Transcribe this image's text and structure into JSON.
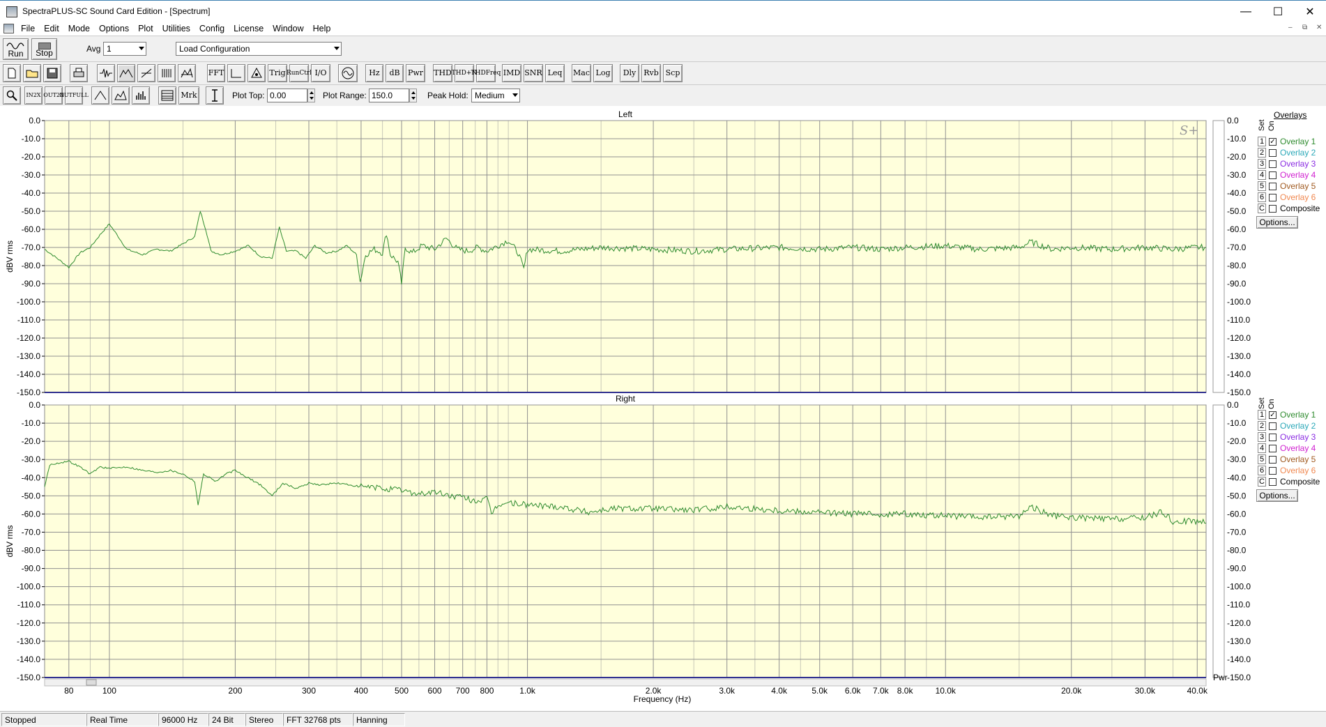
{
  "window": {
    "title": "SpectraPLUS-SC Sound Card Edition - [Spectrum]",
    "minimize_glyph": "—",
    "maximize_glyph": "☐",
    "close_glyph": "✕",
    "mdi_controls": [
      "–",
      "⧉",
      "✕"
    ]
  },
  "menu": [
    "File",
    "Edit",
    "Mode",
    "Options",
    "Plot",
    "Utilities",
    "Config",
    "License",
    "Window",
    "Help"
  ],
  "toolbar1": {
    "run_label": "Run",
    "stop_label": "Stop",
    "avg_label": "Avg",
    "avg_value": "1",
    "config_value": "Load Configuration"
  },
  "toolbar2": {
    "buttons": [
      "FFT",
      "Trig",
      "Run Ctrl",
      "I/O",
      "Hz",
      "dB",
      "Pwr",
      "THD",
      "THD +N",
      "THD Freq",
      "IMD",
      "SNR",
      "Leq",
      "Mac",
      "Log",
      "Dly",
      "Rvb",
      "Scp"
    ]
  },
  "toolbar3": {
    "zoom_buttons": [
      "IN 2X",
      "OUT 2X",
      "OUT FULL"
    ],
    "mrk_label": "Mrk",
    "plot_top_label": "Plot Top:",
    "plot_top_value": "0.00",
    "plot_range_label": "Plot Range:",
    "plot_range_value": "150.0",
    "peak_hold_label": "Peak Hold:",
    "peak_hold_value": "Medium"
  },
  "overlays": {
    "title": "Overlays",
    "set_label": "Set",
    "on_label": "On",
    "items": [
      {
        "set": "1",
        "label": "Overlay 1",
        "color": "#2e8b2e",
        "checked": true
      },
      {
        "set": "2",
        "label": "Overlay 2",
        "color": "#2aa8b8",
        "checked": false
      },
      {
        "set": "3",
        "label": "Overlay 3",
        "color": "#8a2be2",
        "checked": false
      },
      {
        "set": "4",
        "label": "Overlay 4",
        "color": "#d020d0",
        "checked": false
      },
      {
        "set": "5",
        "label": "Overlay 5",
        "color": "#a05a20",
        "checked": false
      },
      {
        "set": "6",
        "label": "Overlay 6",
        "color": "#f08850",
        "checked": false
      },
      {
        "set": "C",
        "label": "Composite",
        "color": "#000000",
        "checked": false
      }
    ],
    "options_label": "Options..."
  },
  "status": [
    "Stopped",
    "Real Time",
    "96000 Hz",
    "24 Bit",
    "Stereo",
    "FFT 32768 pts",
    "Hanning"
  ],
  "chart_data": [
    {
      "type": "line",
      "title": "Left",
      "ylabel": "dBV rms",
      "xlabel": "Frequency (Hz)",
      "xscale": "log",
      "xlim": [
        70,
        42000
      ],
      "ylim": [
        -150,
        0
      ],
      "yticks": [
        "0.0",
        "-10.0",
        "-20.0",
        "-30.0",
        "-40.0",
        "-50.0",
        "-60.0",
        "-70.0",
        "-80.0",
        "-90.0",
        "-100.0",
        "-110.0",
        "-120.0",
        "-130.0",
        "-140.0",
        "-150.0"
      ],
      "xticks": [
        {
          "v": 80,
          "t": "80"
        },
        {
          "v": 100,
          "t": "100"
        },
        {
          "v": 200,
          "t": "200"
        },
        {
          "v": 300,
          "t": "300"
        },
        {
          "v": 400,
          "t": "400"
        },
        {
          "v": 500,
          "t": "500"
        },
        {
          "v": 600,
          "t": "600"
        },
        {
          "v": 700,
          "t": "700"
        },
        {
          "v": 800,
          "t": "800"
        },
        {
          "v": 1000,
          "t": "1.0k"
        },
        {
          "v": 2000,
          "t": "2.0k"
        },
        {
          "v": 3000,
          "t": "3.0k"
        },
        {
          "v": 4000,
          "t": "4.0k"
        },
        {
          "v": 5000,
          "t": "5.0k"
        },
        {
          "v": 6000,
          "t": "6.0k"
        },
        {
          "v": 7000,
          "t": "7.0k"
        },
        {
          "v": 8000,
          "t": "8.0k"
        },
        {
          "v": 10000,
          "t": "10.0k"
        },
        {
          "v": 20000,
          "t": "20.0k"
        },
        {
          "v": 30000,
          "t": "30.0k"
        },
        {
          "v": 40000,
          "t": "40.0k"
        }
      ],
      "series_color": "#2e8b2e",
      "points": [
        [
          70,
          -71
        ],
        [
          75,
          -76
        ],
        [
          80,
          -81
        ],
        [
          85,
          -73
        ],
        [
          90,
          -70
        ],
        [
          95,
          -63
        ],
        [
          100,
          -57
        ],
        [
          105,
          -64
        ],
        [
          110,
          -71
        ],
        [
          120,
          -74
        ],
        [
          130,
          -71
        ],
        [
          140,
          -72
        ],
        [
          150,
          -68
        ],
        [
          160,
          -64
        ],
        [
          165,
          -50
        ],
        [
          170,
          -60
        ],
        [
          175,
          -72
        ],
        [
          185,
          -74
        ],
        [
          200,
          -72
        ],
        [
          215,
          -69
        ],
        [
          230,
          -75
        ],
        [
          245,
          -76
        ],
        [
          255,
          -59
        ],
        [
          265,
          -72
        ],
        [
          280,
          -72
        ],
        [
          295,
          -76
        ],
        [
          310,
          -69
        ],
        [
          330,
          -73
        ],
        [
          350,
          -72
        ],
        [
          370,
          -69
        ],
        [
          390,
          -74
        ],
        [
          398,
          -89
        ],
        [
          410,
          -74
        ],
        [
          430,
          -71
        ],
        [
          450,
          -73
        ],
        [
          460,
          -62
        ],
        [
          470,
          -74
        ],
        [
          490,
          -78
        ],
        [
          500,
          -90
        ],
        [
          510,
          -70
        ],
        [
          530,
          -73
        ],
        [
          560,
          -69
        ],
        [
          600,
          -71
        ],
        [
          640,
          -65
        ],
        [
          680,
          -71
        ],
        [
          720,
          -72
        ],
        [
          760,
          -70
        ],
        [
          800,
          -72
        ],
        [
          850,
          -69
        ],
        [
          900,
          -66
        ],
        [
          950,
          -73
        ],
        [
          980,
          -82
        ],
        [
          1000,
          -71
        ],
        [
          1200,
          -72
        ],
        [
          1500,
          -70
        ],
        [
          2000,
          -71
        ],
        [
          2500,
          -72
        ],
        [
          3000,
          -71
        ],
        [
          4000,
          -70
        ],
        [
          5000,
          -71
        ],
        [
          6000,
          -70
        ],
        [
          7000,
          -71
        ],
        [
          8000,
          -70
        ],
        [
          10000,
          -69
        ],
        [
          12000,
          -71
        ],
        [
          15000,
          -70
        ],
        [
          16000,
          -67
        ],
        [
          18000,
          -71
        ],
        [
          20000,
          -70
        ],
        [
          25000,
          -71
        ],
        [
          30000,
          -70
        ],
        [
          35000,
          -71
        ],
        [
          40000,
          -70
        ],
        [
          42000,
          -70
        ]
      ]
    },
    {
      "type": "line",
      "title": "Right",
      "ylabel": "dBV rms",
      "xlabel": "Frequency (Hz)",
      "xscale": "log",
      "xlim": [
        70,
        42000
      ],
      "ylim": [
        -150,
        0
      ],
      "yticks": [
        "0.0",
        "-10.0",
        "-20.0",
        "-30.0",
        "-40.0",
        "-50.0",
        "-60.0",
        "-70.0",
        "-80.0",
        "-90.0",
        "-100.0",
        "-110.0",
        "-120.0",
        "-130.0",
        "-140.0",
        "-150.0"
      ],
      "xticks": [
        {
          "v": 80,
          "t": "80"
        },
        {
          "v": 100,
          "t": "100"
        },
        {
          "v": 200,
          "t": "200"
        },
        {
          "v": 300,
          "t": "300"
        },
        {
          "v": 400,
          "t": "400"
        },
        {
          "v": 500,
          "t": "500"
        },
        {
          "v": 600,
          "t": "600"
        },
        {
          "v": 700,
          "t": "700"
        },
        {
          "v": 800,
          "t": "800"
        },
        {
          "v": 1000,
          "t": "1.0k"
        },
        {
          "v": 2000,
          "t": "2.0k"
        },
        {
          "v": 3000,
          "t": "3.0k"
        },
        {
          "v": 4000,
          "t": "4.0k"
        },
        {
          "v": 5000,
          "t": "5.0k"
        },
        {
          "v": 6000,
          "t": "6.0k"
        },
        {
          "v": 7000,
          "t": "7.0k"
        },
        {
          "v": 8000,
          "t": "8.0k"
        },
        {
          "v": 10000,
          "t": "10.0k"
        },
        {
          "v": 20000,
          "t": "20.0k"
        },
        {
          "v": 30000,
          "t": "30.0k"
        },
        {
          "v": 40000,
          "t": "40.0k"
        }
      ],
      "series_color": "#2e8b2e",
      "points": [
        [
          70,
          -45
        ],
        [
          72,
          -33
        ],
        [
          75,
          -32
        ],
        [
          80,
          -31
        ],
        [
          85,
          -34
        ],
        [
          90,
          -38
        ],
        [
          95,
          -34
        ],
        [
          100,
          -35
        ],
        [
          110,
          -34
        ],
        [
          120,
          -36
        ],
        [
          130,
          -37
        ],
        [
          140,
          -36
        ],
        [
          150,
          -38
        ],
        [
          160,
          -42
        ],
        [
          163,
          -55
        ],
        [
          168,
          -38
        ],
        [
          180,
          -42
        ],
        [
          190,
          -38
        ],
        [
          200,
          -36
        ],
        [
          210,
          -39
        ],
        [
          230,
          -44
        ],
        [
          245,
          -50
        ],
        [
          260,
          -43
        ],
        [
          280,
          -46
        ],
        [
          300,
          -43
        ],
        [
          320,
          -44
        ],
        [
          350,
          -43
        ],
        [
          400,
          -45
        ],
        [
          450,
          -46
        ],
        [
          500,
          -47
        ],
        [
          550,
          -49
        ],
        [
          600,
          -48
        ],
        [
          650,
          -50
        ],
        [
          700,
          -51
        ],
        [
          750,
          -53
        ],
        [
          800,
          -52
        ],
        [
          820,
          -60
        ],
        [
          850,
          -55
        ],
        [
          900,
          -54
        ],
        [
          1000,
          -55
        ],
        [
          1200,
          -56
        ],
        [
          1400,
          -59
        ],
        [
          1600,
          -57
        ],
        [
          2000,
          -57
        ],
        [
          2500,
          -58
        ],
        [
          3000,
          -56
        ],
        [
          4000,
          -58
        ],
        [
          5000,
          -59
        ],
        [
          6000,
          -60
        ],
        [
          8000,
          -60
        ],
        [
          10000,
          -61
        ],
        [
          12000,
          -62
        ],
        [
          15000,
          -61
        ],
        [
          16000,
          -56
        ],
        [
          18000,
          -61
        ],
        [
          20000,
          -62
        ],
        [
          25000,
          -63
        ],
        [
          30000,
          -62
        ],
        [
          33000,
          -59
        ],
        [
          35000,
          -64
        ],
        [
          40000,
          -64
        ],
        [
          42000,
          -65
        ]
      ]
    }
  ]
}
